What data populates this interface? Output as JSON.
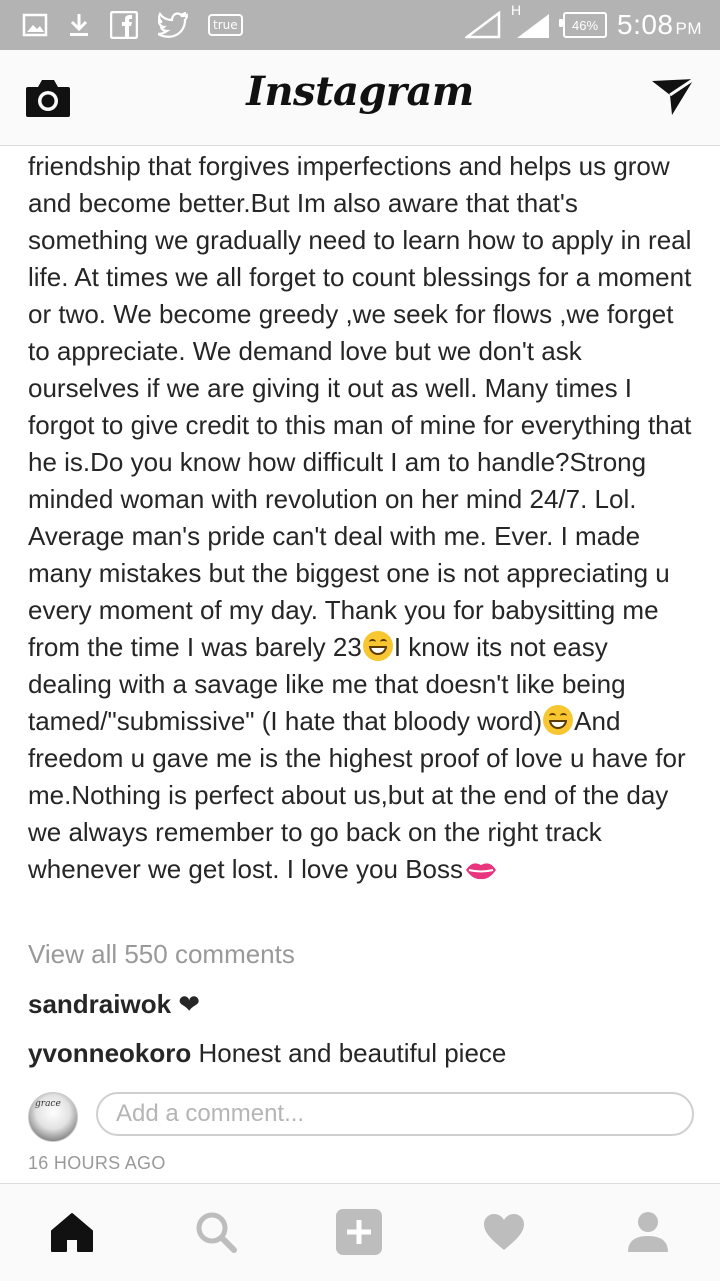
{
  "status_bar": {
    "badge": "true",
    "battery": "46%",
    "time": "5:08",
    "ampm": "PM",
    "network": "H"
  },
  "header": {
    "title": "Instagram",
    "left_icon": "camera-icon",
    "right_icon": "direct-send-icon"
  },
  "post": {
    "caption": {
      "part1": "friendship that forgives imperfections and helps us grow and become better.But Im also aware that that's something we gradually need to learn how to apply in real life. At times we all forget to count blessings for a moment or two. We become greedy ,we seek for flows ,we forget to appreciate. We demand love but we don't ask ourselves if we are giving it out as well. Many times I forgot to give credit to this man of mine for everything that he is.Do you know how difficult I am to handle?Strong minded woman with revolution on her mind 24/7. Lol. Average man's pride can't deal with me. Ever. I made many mistakes but the biggest one is not appreciating u every moment of my day. Thank you for babysitting me from the time I was barely 23",
      "part2": "I know its not easy dealing with a savage like me that doesn't like being tamed/\"submissive\" (I hate that bloody word)",
      "part3": "And freedom u gave me is the highest proof of love u have for me.Nothing is perfect about us,but at the end of the day we always remember to go back on the right track whenever we get lost. I love you Boss"
    },
    "view_all": "View all 550 comments",
    "comments": [
      {
        "user": "sandraiwok",
        "text": "❤"
      },
      {
        "user": "yvonneokoro",
        "text": "Honest and beautiful piece"
      }
    ],
    "add_comment_placeholder": "Add a comment...",
    "timestamp": "16 HOURS AGO",
    "avatar_text": "grace"
  },
  "bottom_nav": [
    "home-icon",
    "search-icon",
    "add-icon",
    "heart-icon",
    "profile-icon"
  ],
  "colors": {
    "status_bar": "#b3b3b3",
    "muted_text": "#999999",
    "kiss_emoji": "#e8357d",
    "grin_emoji": "#f8c630"
  }
}
